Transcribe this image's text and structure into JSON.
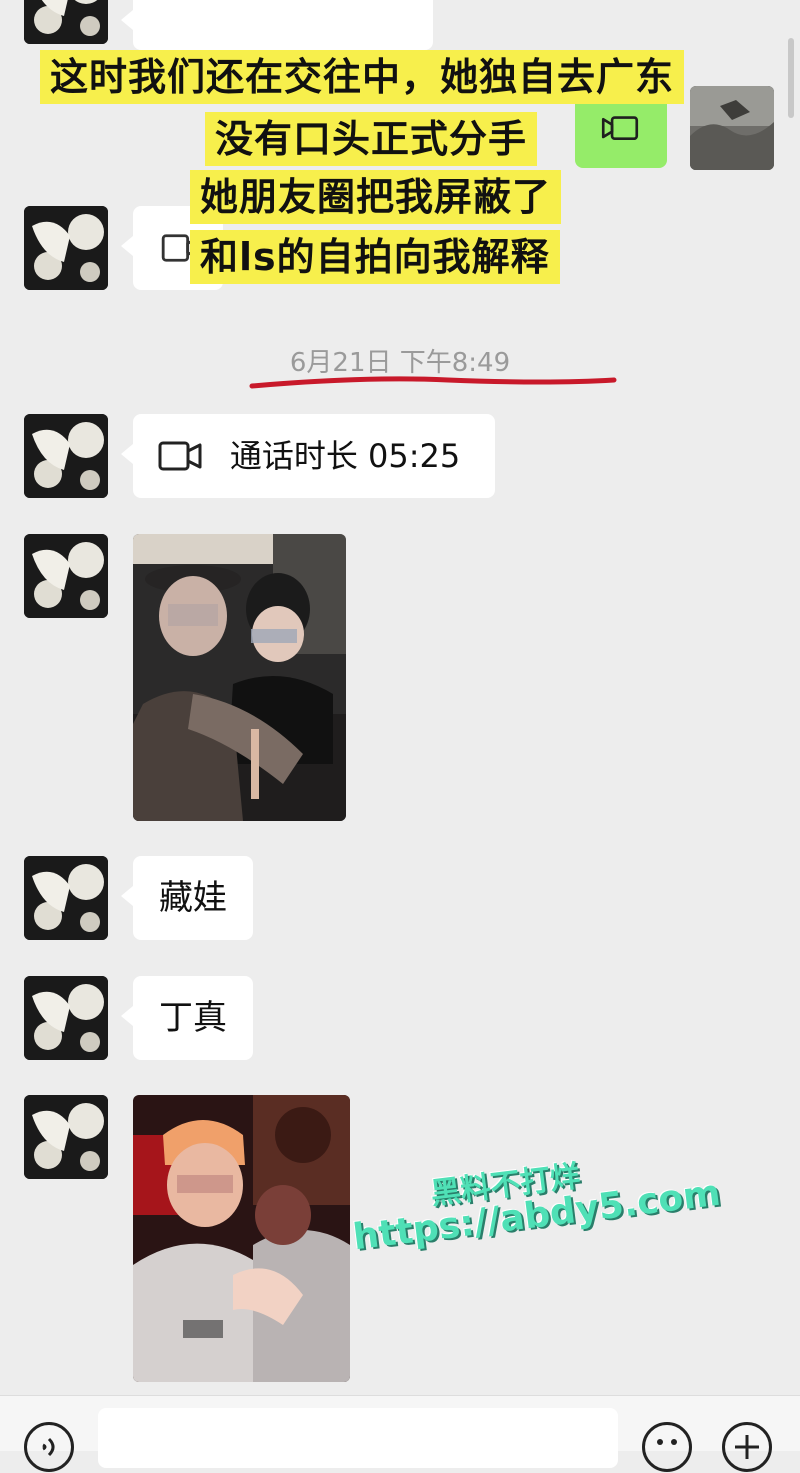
{
  "caption": {
    "lines": [
      "这时我们还在交往中，她独自去广东",
      "没有口头正式分手",
      "她朋友圈把我屏蔽了",
      "和ls的自拍向我解释"
    ],
    "highlight_color": "#f7ef4c"
  },
  "chat": {
    "timestamp": "6月21日 下午8:49",
    "call_label": "通话时长 05:25",
    "message_1": "藏娃",
    "message_2": "丁真"
  },
  "watermark": {
    "line1": "黑料不打烊",
    "line2": "https://abdy5.com"
  },
  "icons": {
    "video_call": "video-camera-icon",
    "voice": "voice-icon",
    "emoji": "emoji-icon",
    "plus": "plus-icon"
  },
  "colors": {
    "background": "#ededed",
    "bubble": "#ffffff",
    "sent_bubble": "#95ec69",
    "underline": "#c8192a"
  }
}
